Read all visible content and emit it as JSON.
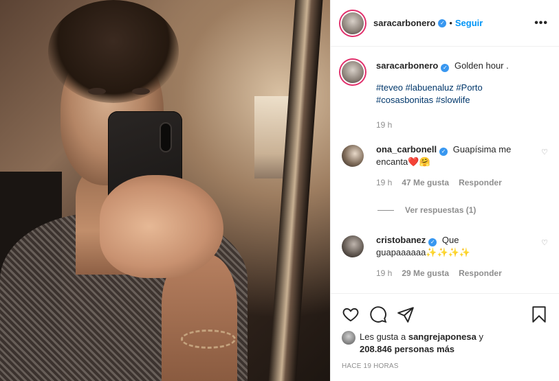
{
  "header": {
    "username": "saracarbonero",
    "dot": "•",
    "follow_label": "Seguir",
    "more_label": "•••"
  },
  "caption": {
    "username": "saracarbonero",
    "text": "Golden hour .",
    "hashtags": [
      "#teveo",
      "#labuenaluz",
      "#Porto",
      "#cosasbonitas",
      "#slowlife"
    ],
    "time": "19 h"
  },
  "comments": [
    {
      "username": "ona_carbonell",
      "text_a": "Guapísima me",
      "text_b": "encanta",
      "emoji": "❤️🤗",
      "time": "19 h",
      "likes": "47 Me gusta",
      "reply_label": "Responder",
      "view_replies": "Ver respuestas (1)"
    },
    {
      "username": "cristobanez",
      "text_a": "Que",
      "text_b": "guapaaaaaa",
      "emoji": "✨✨✨✨",
      "time": "19 h",
      "likes": "29 Me gusta",
      "reply_label": "Responder"
    }
  ],
  "likes": {
    "prefix": "Les gusta a",
    "user": "sangrejaponesa",
    "joiner": "y",
    "others": "208.846 personas más"
  },
  "timestamp": "HACE 19 HORAS",
  "icons": {
    "like": "heart-icon",
    "comment": "comment-icon",
    "share": "share-icon",
    "save": "bookmark-icon",
    "verified": "verified-badge-icon",
    "comment_like": "small-heart-icon"
  },
  "colors": {
    "accent": "#0095f6",
    "verified": "#3897f0",
    "muted": "#8e8e8e",
    "hashtag": "#00376b",
    "text": "#262626"
  }
}
